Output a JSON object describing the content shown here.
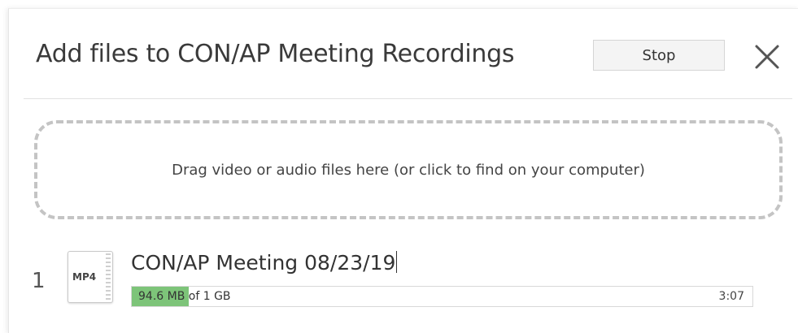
{
  "dialog": {
    "title": "Add files to CON/AP Meeting Recordings",
    "stop_label": "Stop",
    "close_icon": "close-icon"
  },
  "dropzone": {
    "text": "Drag video or audio files here (or click to find on your computer)"
  },
  "files": [
    {
      "index": "1",
      "type_label": "MP4",
      "icon": "video-file-icon",
      "name": "CON/AP Meeting 08/23/19",
      "uploaded": "94.6 MB",
      "of_text": "of",
      "total": "1 GB",
      "duration": "3:07",
      "progress_fraction": 0.092
    }
  ],
  "colors": {
    "progress_fill": "#7dc479",
    "dropzone_border": "#c4c4c4"
  }
}
